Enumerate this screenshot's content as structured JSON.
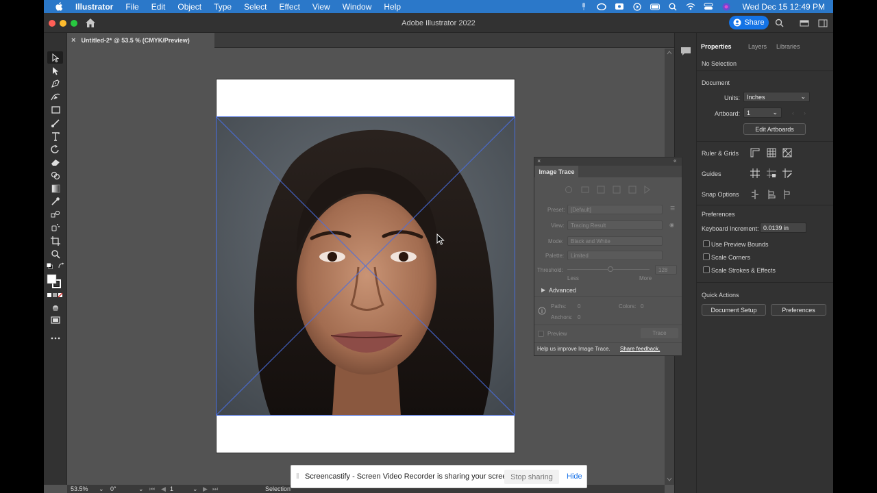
{
  "menubar": {
    "app_name": "Illustrator",
    "items": [
      "File",
      "Edit",
      "Object",
      "Type",
      "Select",
      "Effect",
      "View",
      "Window",
      "Help"
    ],
    "clock": "Wed Dec 15  12:49 PM"
  },
  "titlebar": {
    "title": "Adobe Illustrator 2022",
    "share_label": "Share"
  },
  "document_tab": {
    "label": "Untitled-2* @ 53.5 % (CMYK/Preview)",
    "close_glyph": "×"
  },
  "statusbar": {
    "zoom": "53.5%",
    "rotation": "0°",
    "artboard": "1",
    "tool": "Selection"
  },
  "properties": {
    "tabs": [
      "Properties",
      "Layers",
      "Libraries"
    ],
    "selection": "No Selection",
    "document_heading": "Document",
    "units_label": "Units:",
    "units_value": "Inches",
    "artboard_label": "Artboard:",
    "artboard_value": "1",
    "edit_artboards": "Edit Artboards",
    "ruler_grids": "Ruler & Grids",
    "guides": "Guides",
    "snap_options": "Snap Options",
    "preferences_heading": "Preferences",
    "keyboard_increment_label": "Keyboard Increment:",
    "keyboard_increment_value": "0.0139 in",
    "checkboxes": [
      "Use Preview Bounds",
      "Scale Corners",
      "Scale Strokes & Effects"
    ],
    "quick_actions": "Quick Actions",
    "document_setup": "Document Setup",
    "preferences_button": "Preferences"
  },
  "image_trace": {
    "title": "Image Trace",
    "preset_label": "Preset:",
    "preset_value": "[Default]",
    "view_label": "View:",
    "view_value": "Tracing Result",
    "mode_label": "Mode:",
    "mode_value": "Black and White",
    "palette_label": "Palette:",
    "palette_value": "Limited",
    "threshold_label": "Threshold:",
    "threshold_value": "128",
    "less": "Less",
    "more": "More",
    "advanced": "Advanced",
    "paths_label": "Paths:",
    "paths_value": "0",
    "colors_label": "Colors:",
    "colors_value": "0",
    "anchors_label": "Anchors:",
    "anchors_value": "0",
    "preview": "Preview",
    "trace_button": "Trace",
    "help_text": "Help us improve Image Trace.",
    "feedback_link": "Share feedback."
  },
  "sharing_bar": {
    "message": "Screencastify - Screen Video Recorder is sharing your screen.",
    "stop_label": "Stop sharing",
    "hide_label": "Hide"
  },
  "colors": {
    "menubar": "#2b78c9",
    "accent": "#1473e6",
    "panel": "#323232",
    "canvas": "#535353"
  }
}
